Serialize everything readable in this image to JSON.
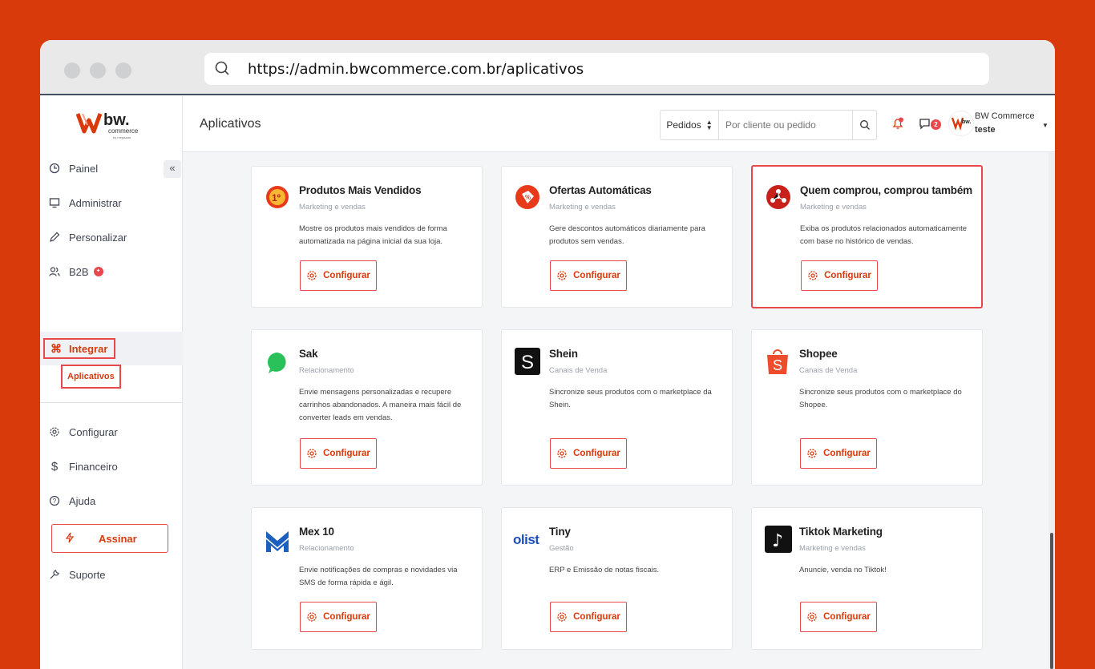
{
  "browser": {
    "url": "https://admin.bwcommerce.com.br/aplicativos"
  },
  "sidebar": {
    "logo_text": "bw.",
    "logo_sub": "commerce",
    "logo_tiny": "by megaaaa",
    "collapse": "«",
    "items": [
      {
        "label": "Painel"
      },
      {
        "label": "Administrar"
      },
      {
        "label": "Personalizar"
      },
      {
        "label": "B2B"
      },
      {
        "label": "Integrar"
      },
      {
        "label": "Configurar"
      },
      {
        "label": "Financeiro"
      },
      {
        "label": "Ajuda"
      },
      {
        "label": "Suporte"
      }
    ],
    "sub_item": "Aplicativos",
    "b2b_badge": "✦",
    "assinar": "Assinar"
  },
  "topbar": {
    "title": "Aplicativos",
    "select_value": "Pedidos",
    "search_placeholder": "Por cliente ou pedido",
    "chat_count": "2",
    "user_name": "BW Commerce",
    "user_sub": "teste"
  },
  "apps": [
    {
      "title": "Produtos Mais Vendidos",
      "category": "Marketing e vendas",
      "desc": "Mostre os produtos mais vendidos de forma automatizada na página inicial da sua loja.",
      "button": "Configurar",
      "icon": "medal-icon",
      "icon_text": "1º"
    },
    {
      "title": "Ofertas Automáticas",
      "category": "Marketing e vendas",
      "desc": "Gere descontos automáticos diariamente para produtos sem vendas.",
      "button": "Configurar",
      "icon": "offer-tag-icon",
      "icon_text": "%"
    },
    {
      "title": "Quem comprou, comprou também",
      "category": "Marketing e vendas",
      "desc": "Exiba os produtos relacionados automaticamente com base no histórico de vendas.",
      "button": "Configurar",
      "icon": "network-icon"
    },
    {
      "title": "Sak",
      "category": "Relacionamento",
      "desc": "Envie mensagens personalizadas e recupere carrinhos abandonados. A maneira mais fácil de converter leads em vendas.",
      "button": "Configurar",
      "icon": "sak-bubble-icon"
    },
    {
      "title": "Shein",
      "category": "Canais de Venda",
      "desc": "Sincronize seus produtos com o marketplace da Shein.",
      "button": "Configurar",
      "icon": "shein-logo-icon",
      "icon_text": "S"
    },
    {
      "title": "Shopee",
      "category": "Canais de Venda",
      "desc": "Sincronize seus produtos com o marketplace do Shopee.",
      "button": "Configurar",
      "icon": "shopee-bag-icon",
      "icon_text": "S"
    },
    {
      "title": "Mex 10",
      "category": "Relacionamento",
      "desc": "Envie notificações de compras e novidades via SMS de forma rápida e ágil.",
      "button": "Configurar",
      "icon": "mex10-logo-icon"
    },
    {
      "title": "Tiny",
      "category": "Gestão",
      "desc": "ERP e Emissão de notas fiscais.",
      "button": "Configurar",
      "icon": "olist-logo-icon",
      "icon_text": "olist"
    },
    {
      "title": "Tiktok Marketing",
      "category": "Marketing e vendas",
      "desc": "Anuncie, venda no Tiktok!",
      "button": "Configurar",
      "icon": "tiktok-logo-icon",
      "icon_text": "♪"
    }
  ],
  "colors": {
    "brand": "#d93a0c",
    "accent_red": "#e8474c"
  }
}
